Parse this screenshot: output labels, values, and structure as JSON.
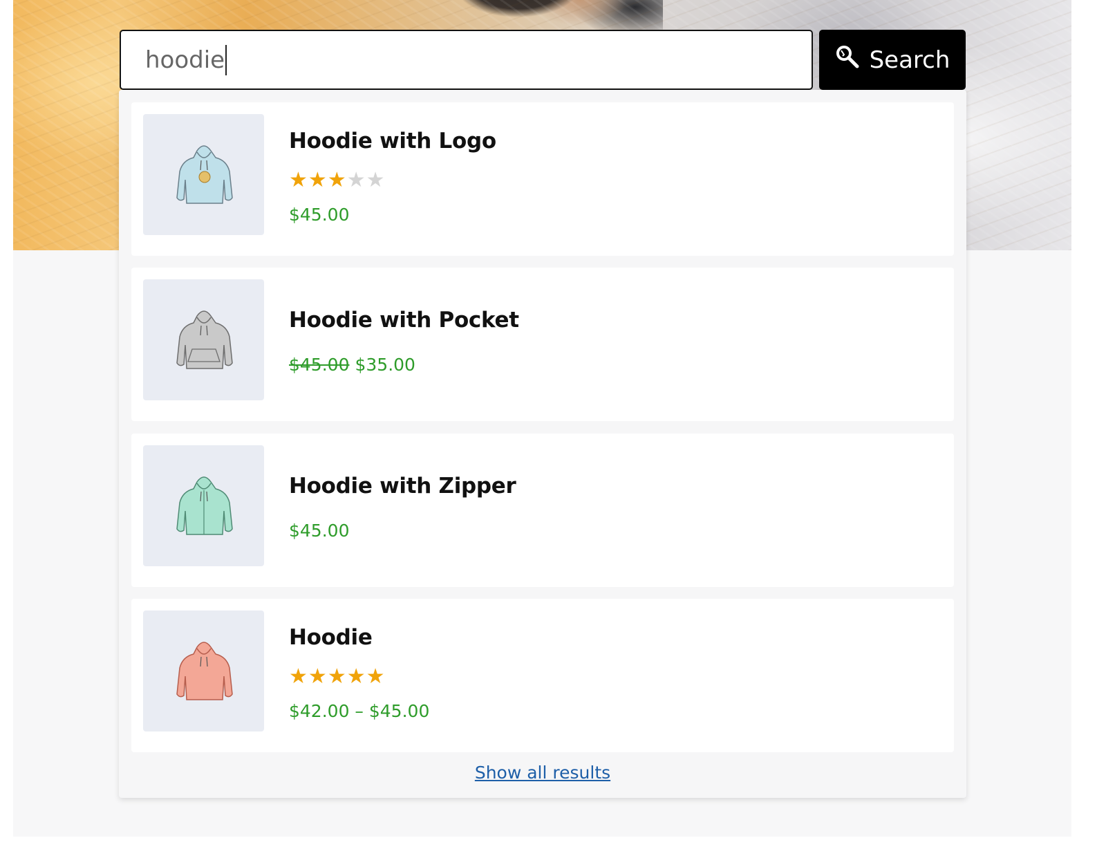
{
  "search": {
    "value": "hoodie",
    "button_label": "Search"
  },
  "results": [
    {
      "title": "Hoodie with Logo",
      "rating": 3,
      "rating_max": 5,
      "price": "$45.00",
      "color": "#bfe0ea"
    },
    {
      "title": "Hoodie with Pocket",
      "regular_price": "$45.00",
      "sale_price": "$35.00",
      "color": "#c9c9c9"
    },
    {
      "title": "Hoodie with Zipper",
      "price": "$45.00",
      "color": "#a9e3cf"
    },
    {
      "title": "Hoodie",
      "rating": 5,
      "rating_max": 5,
      "price": "$42.00 – $45.00",
      "color": "#f3a796"
    }
  ],
  "show_all_label": "Show all results",
  "colors": {
    "price": "#2e9c2a",
    "star": "#f0a30a",
    "link": "#1e5fa8"
  }
}
